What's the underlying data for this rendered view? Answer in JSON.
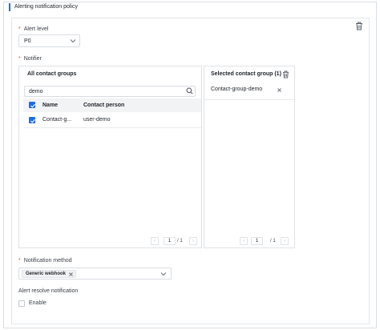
{
  "section": {
    "title": "Alerting notification policy"
  },
  "alert_level": {
    "label": "Alert level",
    "required_mark": "*",
    "value": "P0"
  },
  "notifier": {
    "label": "Notifier",
    "required_mark": "*",
    "all_groups": {
      "header": "All contact groups",
      "search": {
        "value": "demo"
      },
      "columns": [
        "Name",
        "Contact person"
      ],
      "header_checked": true,
      "rows": [
        {
          "name": "Contact-g...",
          "contact_person": "user-demo",
          "checked": true
        }
      ],
      "pager": {
        "current": "1",
        "total": "/ 1",
        "prev": "‹",
        "next": "›"
      }
    },
    "selected_groups": {
      "header": "Selected contact group (1)",
      "items": [
        "Contact-group-demo"
      ],
      "pager": {
        "current": "1",
        "total": "/ 1",
        "prev": "‹",
        "next": "›"
      }
    }
  },
  "notification_method": {
    "label": "Notification method",
    "required_mark": "*",
    "tags": [
      "Generic webhook"
    ]
  },
  "resolve_notification": {
    "label": "Alert resolve notification",
    "enable_label": "Enable",
    "checked": false
  },
  "colors": {
    "accent": "#1c6cf0",
    "required": "#e54545",
    "border": "#d9dde3"
  },
  "icons": [
    "trash-icon",
    "chevron-down-icon",
    "search-icon",
    "checkbox-checked-icon",
    "close-icon"
  ]
}
